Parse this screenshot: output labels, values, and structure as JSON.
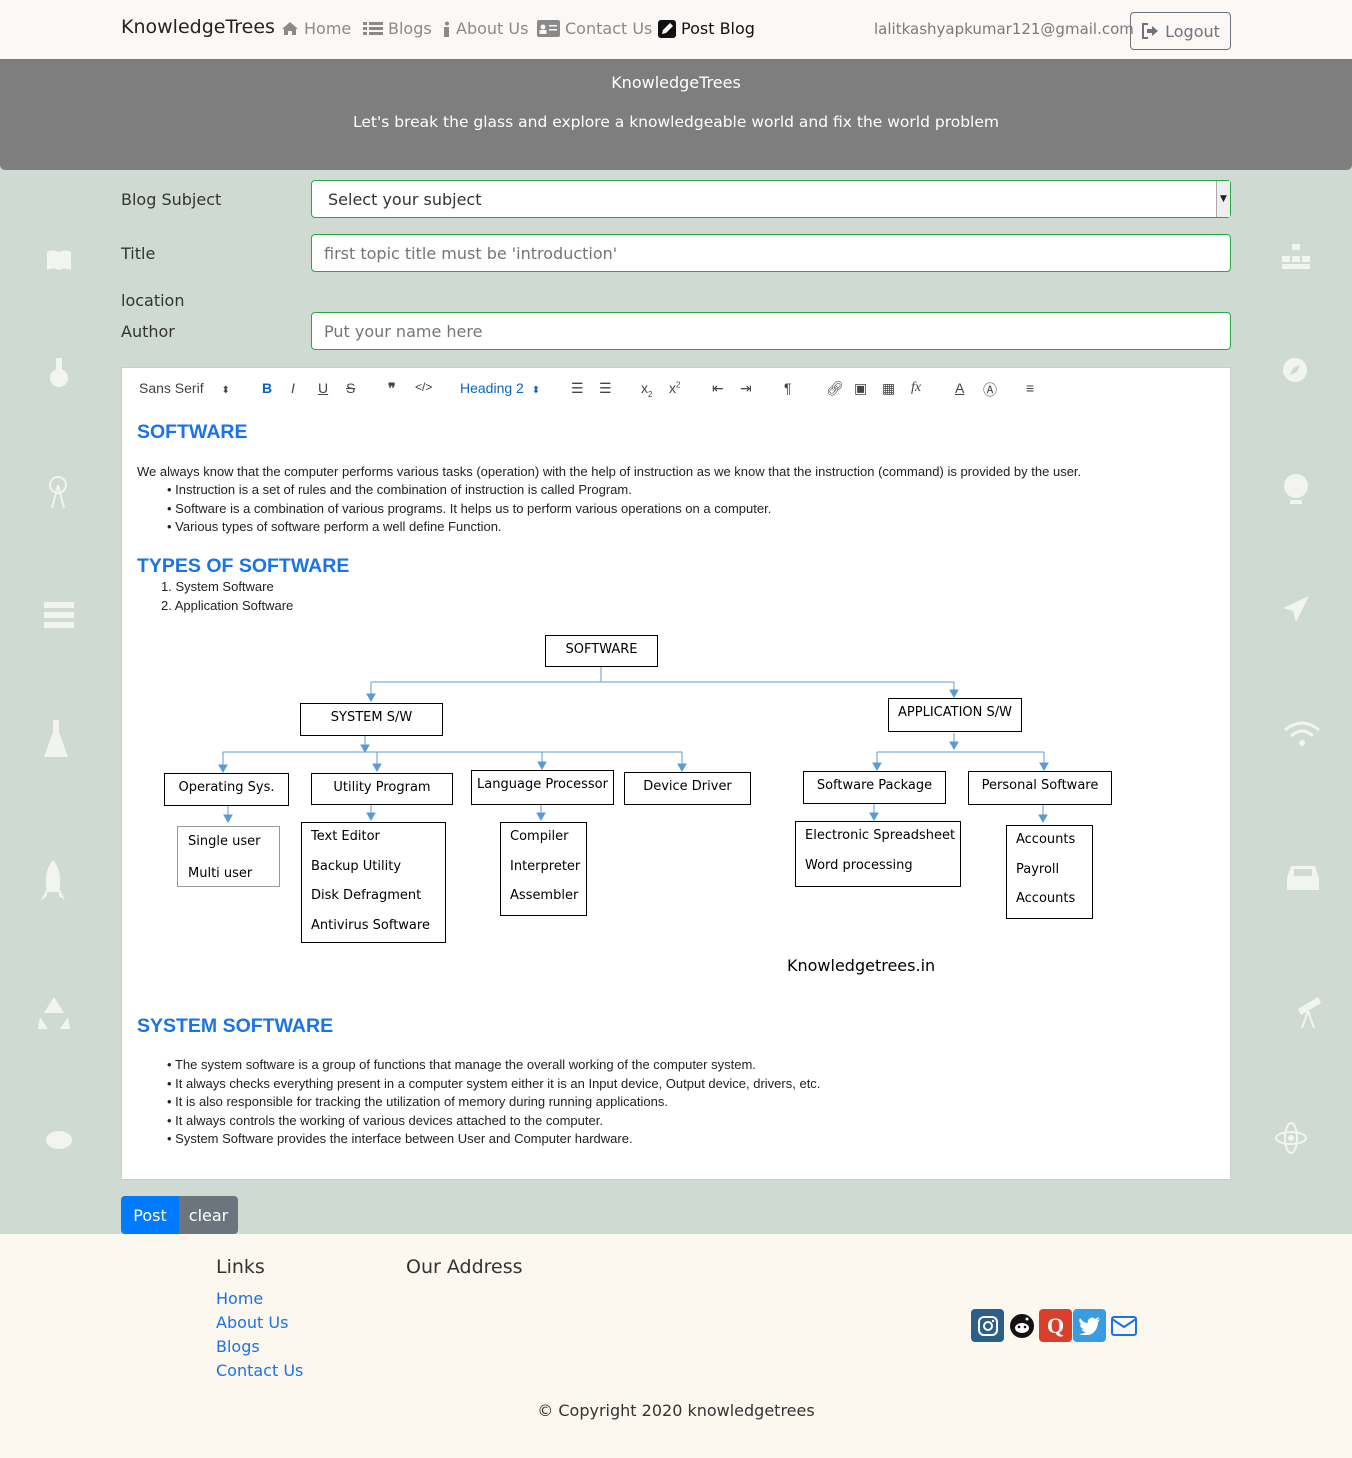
{
  "navbar": {
    "brand": "KnowledgeTrees",
    "items": [
      {
        "label": "Home",
        "icon": "home-icon"
      },
      {
        "label": "Blogs",
        "icon": "list-icon"
      },
      {
        "label": "About Us",
        "icon": "info-icon"
      },
      {
        "label": "Contact Us",
        "icon": "address-card-icon"
      },
      {
        "label": "Post Blog",
        "icon": "edit-icon"
      }
    ],
    "user_email": "lalitkashyapkumar121@gmail.com",
    "logout_label": "Logout"
  },
  "jumbotron": {
    "title": "KnowledgeTrees",
    "subtitle": "Let's break the glass and explore a knowledgeable world and fix the world problem"
  },
  "form": {
    "subject_label": "Blog Subject",
    "subject_value": "Select your subject",
    "title_label": "Title",
    "title_placeholder": "first topic title must be 'introduction'",
    "location_label": "location",
    "author_label": "Author",
    "author_placeholder": "Put your name here"
  },
  "toolbar": {
    "font": "Sans Serif",
    "heading": "Heading 2"
  },
  "content": {
    "h_software": "SOFTWARE",
    "intro": "We always know that the computer performs various tasks (operation) with the help of instruction as we know that the instruction (command) is provided by the user.",
    "bullets1": [
      "Instruction is a set of rules and the combination of instruction is called Program.",
      "Software is a combination of various programs. It helps us to perform various operations on a computer.",
      "Various types of software perform a well define Function."
    ],
    "h_types": "TYPES OF SOFTWARE",
    "types": [
      "System Software",
      "Application Software"
    ],
    "h_system": "SYSTEM SOFTWARE",
    "bullets2": [
      "The system software is a group of functions that manage the overall working of the computer system.",
      "It always checks everything present in a computer system either it is an Input device, Output device, drivers, etc.",
      "It is also responsible for tracking the utilization of memory during running applications.",
      "It always controls the working of various devices attached to the computer.",
      "System Software provides the interface between User and Computer hardware."
    ]
  },
  "diagram": {
    "root": "SOFTWARE",
    "system": "SYSTEM S/W",
    "application": "APPLICATION S/W",
    "os": "Operating Sys.",
    "utility": "Utility Program",
    "language": "Language Processor",
    "driver": "Device Driver",
    "package": "Software Package",
    "personal": "Personal Software",
    "os_items": [
      "Single user",
      "Multi user"
    ],
    "utility_items": [
      "Text Editor",
      "Backup Utility",
      "Disk Defragment",
      "Antivirus Software"
    ],
    "language_items": [
      "Compiler",
      "Interpreter",
      "Assembler"
    ],
    "package_items": [
      "Electronic Spreadsheet",
      "Word processing"
    ],
    "personal_items": [
      "Accounts",
      "Payroll",
      "Accounts"
    ],
    "watermark": "Knowledgetrees.in"
  },
  "buttons": {
    "post": "Post",
    "clear": "clear"
  },
  "footer": {
    "links_title": "Links",
    "links": [
      "Home",
      "About Us",
      "Blogs",
      "Contact Us"
    ],
    "address_title": "Our Address",
    "social": [
      "instagram-icon",
      "reddit-icon",
      "quora-icon",
      "twitter-icon",
      "mail-icon"
    ],
    "copyright": "© Copyright 2020 knowledgetrees"
  },
  "colors": {
    "accent": "#007bff",
    "heading": "#1a73e8",
    "valid_border": "#28a745",
    "background": "#cfdbd2",
    "jumbotron": "#7e7e7e"
  }
}
